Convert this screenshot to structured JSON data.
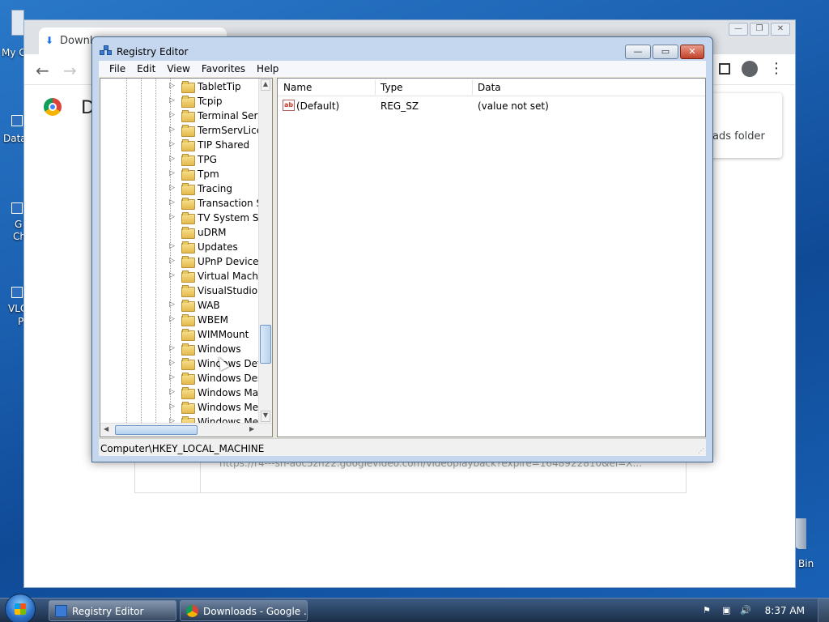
{
  "desktop": {
    "icon_labels": [
      "My C",
      "Data",
      "G",
      "Ch",
      "VLC",
      "P"
    ],
    "recycle_bin_label": "Bin"
  },
  "chrome": {
    "tab_title": "Downlo",
    "page_heading": "D",
    "notification_text": "ads folder",
    "download_url": "https://r4---sn-aoc5zh22.googlevideo.com/videoplayback?expire=1648922810&ei=X..."
  },
  "regedit": {
    "title": "Registry Editor",
    "menu": [
      "File",
      "Edit",
      "View",
      "Favorites",
      "Help"
    ],
    "tree_items": [
      {
        "label": "TabletTip",
        "expandable": true
      },
      {
        "label": "Tcpip",
        "expandable": true
      },
      {
        "label": "Terminal Serve",
        "expandable": true
      },
      {
        "label": "TermServLicen",
        "expandable": true
      },
      {
        "label": "TIP Shared",
        "expandable": true
      },
      {
        "label": "TPG",
        "expandable": true
      },
      {
        "label": "Tpm",
        "expandable": true
      },
      {
        "label": "Tracing",
        "expandable": true
      },
      {
        "label": "Transaction Se",
        "expandable": true
      },
      {
        "label": "TV System Serv",
        "expandable": true
      },
      {
        "label": "uDRM",
        "expandable": false
      },
      {
        "label": "Updates",
        "expandable": true
      },
      {
        "label": "UPnP Device H",
        "expandable": true
      },
      {
        "label": "Virtual Machin",
        "expandable": true
      },
      {
        "label": "VisualStudio",
        "expandable": false
      },
      {
        "label": "WAB",
        "expandable": true
      },
      {
        "label": "WBEM",
        "expandable": true
      },
      {
        "label": "WIMMount",
        "expandable": false
      },
      {
        "label": "Windows",
        "expandable": true
      },
      {
        "label": "Windows Defe",
        "expandable": true
      },
      {
        "label": "Windows Desk",
        "expandable": true
      },
      {
        "label": "Windows Mail",
        "expandable": true
      },
      {
        "label": "Windows Med",
        "expandable": true
      },
      {
        "label": "Windows Med",
        "expandable": true
      }
    ],
    "columns": {
      "name": "Name",
      "type": "Type",
      "data": "Data"
    },
    "values": [
      {
        "name": "(Default)",
        "type": "REG_SZ",
        "data": "(value not set)",
        "icon": "string-value-icon"
      }
    ],
    "status_path": "Computer\\HKEY_LOCAL_MACHINE"
  },
  "taskbar": {
    "buttons": [
      {
        "label": "Registry Editor",
        "icon": "regedit-icon"
      },
      {
        "label": "Downloads - Google ...",
        "icon": "chrome-icon"
      }
    ],
    "clock": "8:37 AM"
  },
  "colors": {
    "desktop": "#1b5fb0",
    "titlebar": "#c5d7ee",
    "taskbar": "#1b2e48"
  }
}
